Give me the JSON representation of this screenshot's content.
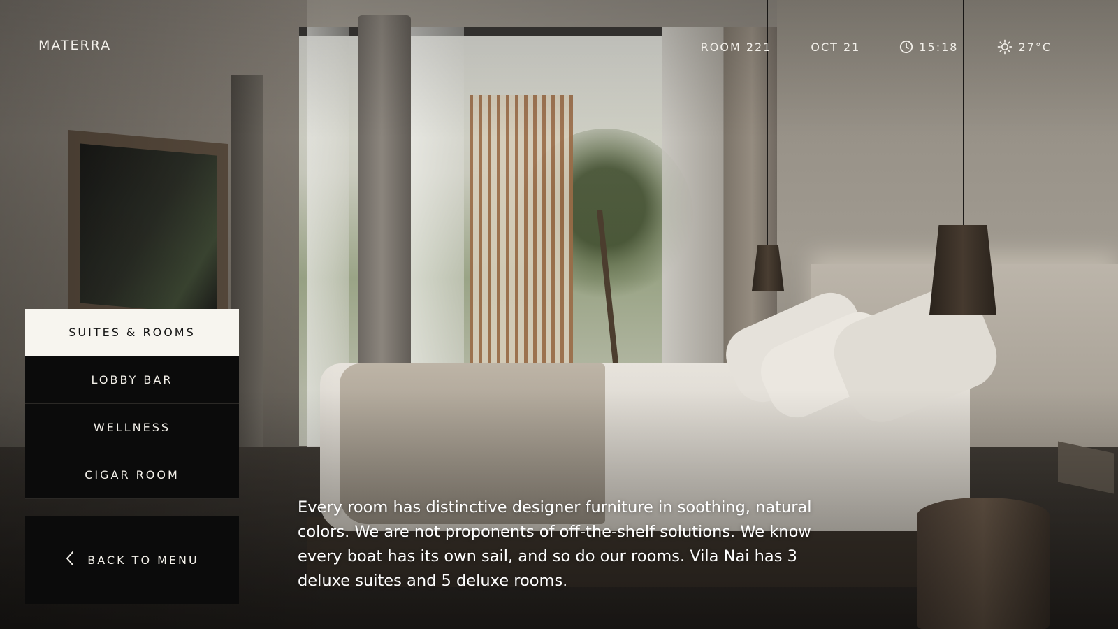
{
  "brand": {
    "name": "MATERRA"
  },
  "status_bar": {
    "room": "ROOM 221",
    "date": "OCT 21",
    "time": "15:18",
    "temperature": "27°C",
    "time_icon": "clock-icon",
    "weather_icon": "sun-icon"
  },
  "menu": {
    "items": [
      {
        "label": "SUITES & ROOMS",
        "active": true
      },
      {
        "label": "LOBBY BAR",
        "active": false
      },
      {
        "label": "WELLNESS",
        "active": false
      },
      {
        "label": "CIGAR ROOM",
        "active": false
      }
    ],
    "back_label": "BACK TO MENU",
    "back_icon": "chevron-left-icon"
  },
  "content": {
    "description": "Every room has distinctive designer furniture in soothing, natural colors. We are not proponents of off-the-shelf solutions. We know every boat has its own sail, and so do our rooms. Vila Nai has 3 deluxe suites and 5 deluxe rooms."
  },
  "colors": {
    "menu_bg": "#0b0b0b",
    "menu_active_bg": "#f7f5ef",
    "text_light": "#f3f0ea"
  }
}
